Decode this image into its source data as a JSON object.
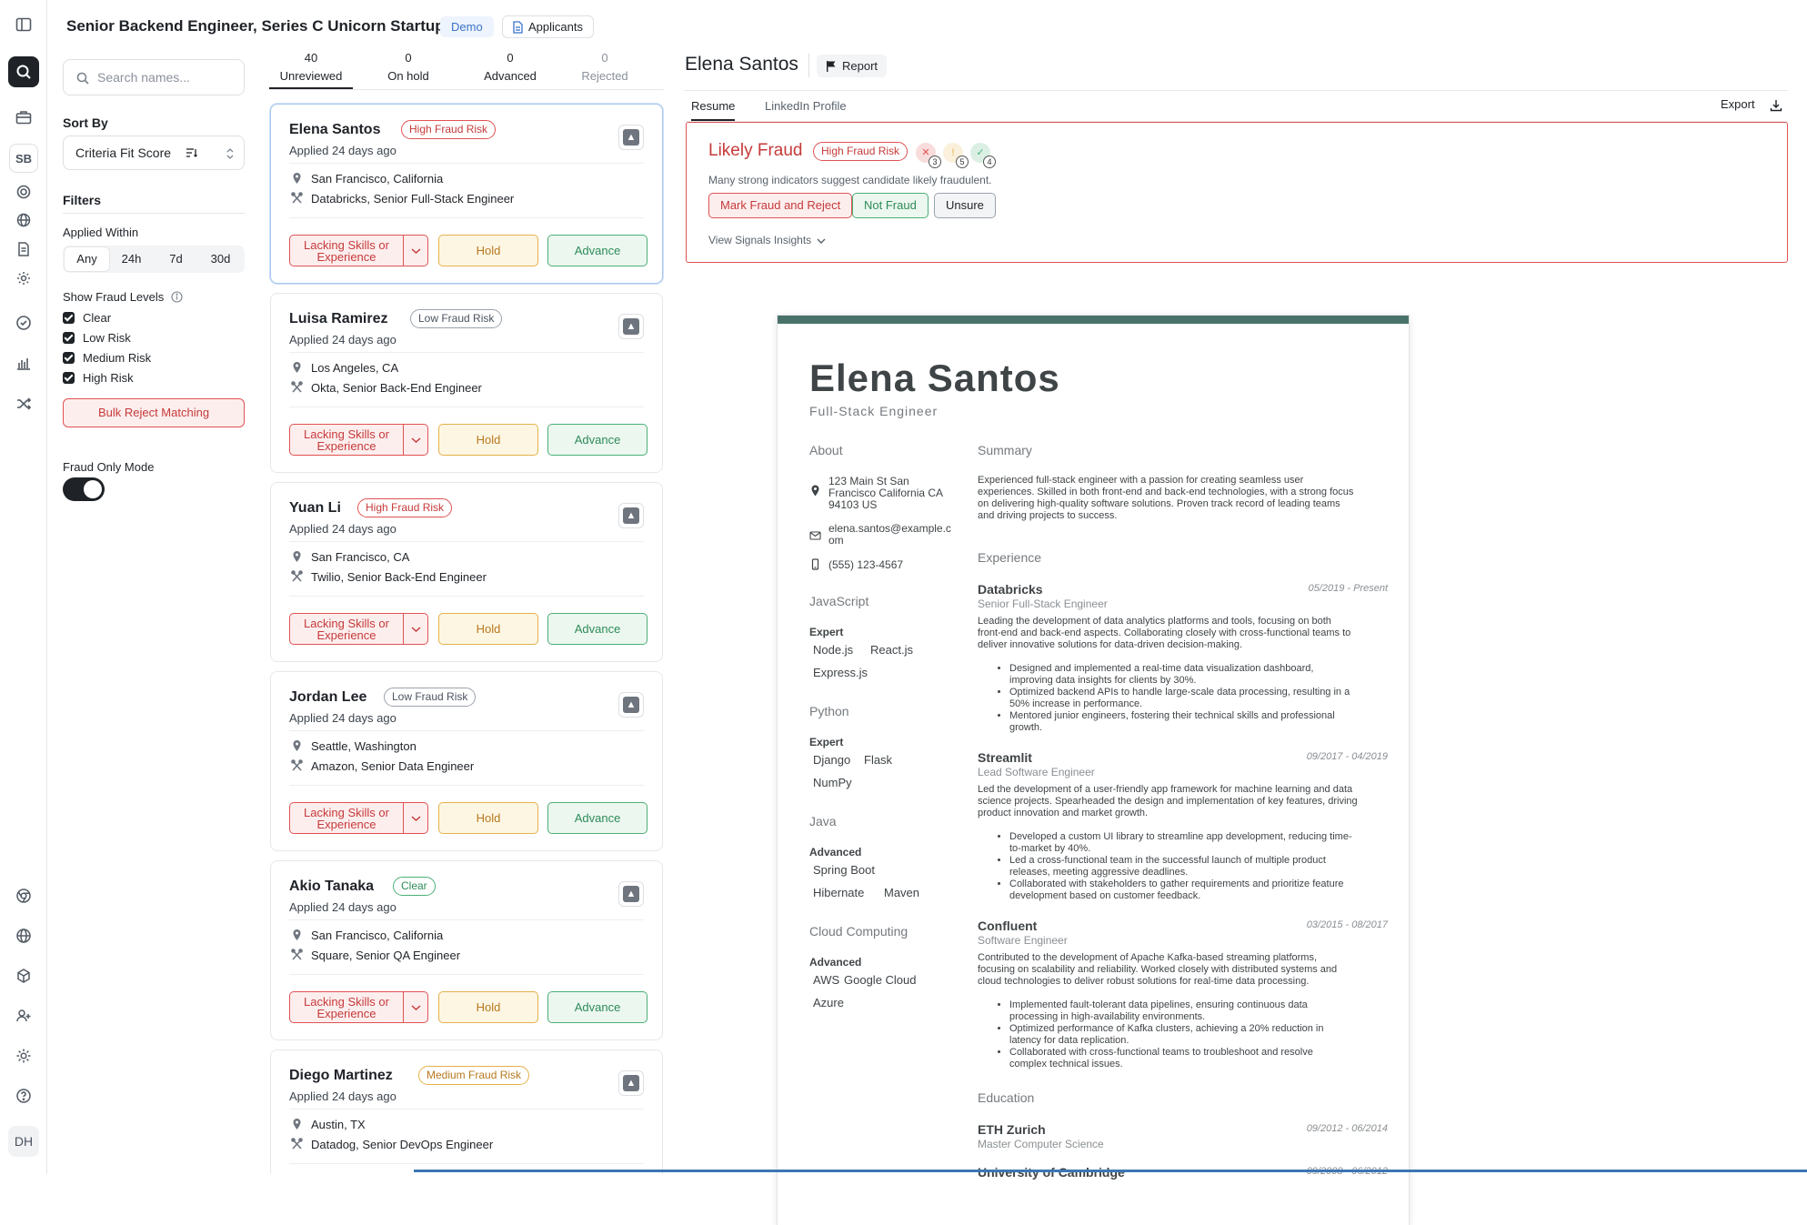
{
  "header": {
    "title": "Senior Backend Engineer, Series C Unicorn Startup",
    "demo_label": "Demo",
    "applicants_label": "Applicants"
  },
  "rail": {
    "sb_label": "SB",
    "user_initials": "DH"
  },
  "filters": {
    "search_placeholder": "Search names...",
    "sort_label": "Sort By",
    "sort_value": "Criteria Fit Score",
    "filters_label": "Filters",
    "applied_within_label": "Applied Within",
    "applied_within_options": [
      "Any",
      "24h",
      "7d",
      "30d"
    ],
    "fraud_levels_label": "Show Fraud Levels",
    "fraud_levels": [
      "Clear",
      "Low Risk",
      "Medium Risk",
      "High Risk"
    ],
    "bulk_reject_label": "Bulk Reject Matching",
    "fraud_only_label": "Fraud Only Mode"
  },
  "tabs": [
    {
      "count": "40",
      "label": "Unreviewed"
    },
    {
      "count": "0",
      "label": "On hold"
    },
    {
      "count": "0",
      "label": "Advanced"
    },
    {
      "count": "0",
      "label": "Rejected"
    }
  ],
  "card_actions": {
    "reject": "Lacking Skills or Experience",
    "hold": "Hold",
    "advance": "Advance"
  },
  "candidates": [
    {
      "name": "Elena Santos",
      "risk": "High Fraud Risk",
      "applied": "Applied 24 days ago",
      "location": "San Francisco, California",
      "job": "Databricks, Senior Full-Stack Engineer"
    },
    {
      "name": "Luisa Ramirez",
      "risk": "Low Fraud Risk",
      "applied": "Applied 24 days ago",
      "location": "Los Angeles, CA",
      "job": "Okta, Senior Back-End Engineer"
    },
    {
      "name": "Yuan Li",
      "risk": "High Fraud Risk",
      "applied": "Applied 24 days ago",
      "location": "San Francisco, CA",
      "job": "Twilio, Senior Back-End Engineer"
    },
    {
      "name": "Jordan Lee",
      "risk": "Low Fraud Risk",
      "applied": "Applied 24 days ago",
      "location": "Seattle, Washington",
      "job": "Amazon, Senior Data Engineer"
    },
    {
      "name": "Akio Tanaka",
      "risk": "Clear",
      "applied": "Applied 24 days ago",
      "location": "San Francisco, California",
      "job": "Square, Senior QA Engineer"
    },
    {
      "name": "Diego Martinez",
      "risk": "Medium Fraud Risk",
      "applied": "Applied 24 days ago",
      "location": "Austin, TX",
      "job": "Datadog, Senior DevOps Engineer"
    }
  ],
  "detail": {
    "name": "Elena Santos",
    "report_label": "Report",
    "tabs": [
      "Resume",
      "LinkedIn Profile"
    ],
    "export_label": "Export",
    "fraud": {
      "title": "Likely Fraud",
      "badge": "High Fraud Risk",
      "signals": [
        {
          "glyph": "✕",
          "count": "3",
          "color": "#e05252"
        },
        {
          "glyph": "!",
          "count": "5",
          "color": "#e4b24a"
        },
        {
          "glyph": "✓",
          "count": "4",
          "color": "#4caf77"
        }
      ],
      "description": "Many strong indicators suggest candidate likely fraudulent.",
      "buttons": [
        "Mark Fraud and Reject",
        "Not Fraud",
        "Unsure"
      ],
      "insights_label": "View Signals Insights"
    }
  },
  "resume": {
    "name": "Elena Santos",
    "role": "Full-Stack Engineer",
    "about_label": "About",
    "address": [
      "123 Main St San",
      "Francisco California CA",
      "94103 US"
    ],
    "email": [
      "elena.santos@example.c",
      "om"
    ],
    "phone": "(555) 123-4567",
    "skills": [
      {
        "group": "JavaScript",
        "level": "Expert",
        "tags": [
          "Node.js",
          "React.js",
          "Express.js"
        ]
      },
      {
        "group": "Python",
        "level": "Expert",
        "tags": [
          "Django",
          "Flask",
          "NumPy"
        ]
      },
      {
        "group": "Java",
        "level": "Advanced",
        "tags": [
          "Spring Boot",
          "Hibernate",
          "Maven"
        ]
      },
      {
        "group": "Cloud Computing",
        "level": "Advanced",
        "tags": [
          "AWS",
          "Google Cloud",
          "Azure"
        ]
      }
    ],
    "summary_label": "Summary",
    "summary": [
      "Experienced full-stack engineer with a passion for creating seamless user",
      "experiences. Skilled in both front-end and back-end technologies, with a strong focus",
      "on delivering high-quality software solutions. Proven track record of leading teams",
      "and driving projects to success."
    ],
    "experience_label": "Experience",
    "experience": [
      {
        "company": "Databricks",
        "title": "Senior Full-Stack Engineer",
        "dates": "05/2019 - Present",
        "description": [
          "Leading the development of data analytics platforms and tools, focusing on both",
          "front-end and back-end aspects. Collaborating closely with cross-functional teams to",
          "deliver innovative solutions for data-driven decision-making."
        ],
        "bullets": [
          [
            "Designed and implemented a real-time data visualization dashboard,",
            "improving data insights for clients by 30%."
          ],
          [
            "Optimized backend APIs to handle large-scale data processing, resulting in a",
            "50% increase in performance."
          ],
          [
            "Mentored junior engineers, fostering their technical skills and professional",
            "growth."
          ]
        ]
      },
      {
        "company": "Streamlit",
        "title": "Lead Software Engineer",
        "dates": "09/2017 - 04/2019",
        "description": [
          "Led the development of a user-friendly app framework for machine learning and data",
          "science projects. Spearheaded the design and implementation of key features, driving",
          "product innovation and market growth."
        ],
        "bullets": [
          [
            "Developed a custom UI library to streamline app development, reducing time-",
            "to-market by 40%."
          ],
          [
            "Led a cross-functional team in the successful launch of multiple product",
            "releases, meeting aggressive deadlines."
          ],
          [
            "Collaborated with stakeholders to gather requirements and prioritize feature",
            "development based on customer feedback."
          ]
        ]
      },
      {
        "company": "Confluent",
        "title": "Software Engineer",
        "dates": "03/2015 - 08/2017",
        "description": [
          "Contributed to the development of Apache Kafka-based streaming platforms,",
          "focusing on scalability and reliability. Worked closely with distributed systems and",
          "cloud technologies to deliver robust solutions for real-time data processing."
        ],
        "bullets": [
          [
            "Implemented fault-tolerant data pipelines, ensuring continuous data",
            "processing in high-availability environments."
          ],
          [
            "Optimized performance of Kafka clusters, achieving a 20% reduction in",
            "latency for data replication."
          ],
          [
            "Collaborated with cross-functional teams to troubleshoot and resolve",
            "complex technical issues."
          ]
        ]
      }
    ],
    "education_label": "Education",
    "education": [
      {
        "school": "ETH Zurich",
        "degree": "Master Computer Science",
        "dates": "09/2012 - 06/2014"
      },
      {
        "school": "University of Cambridge",
        "degree": "",
        "dates": "09/2008 - 06/2012"
      }
    ]
  }
}
